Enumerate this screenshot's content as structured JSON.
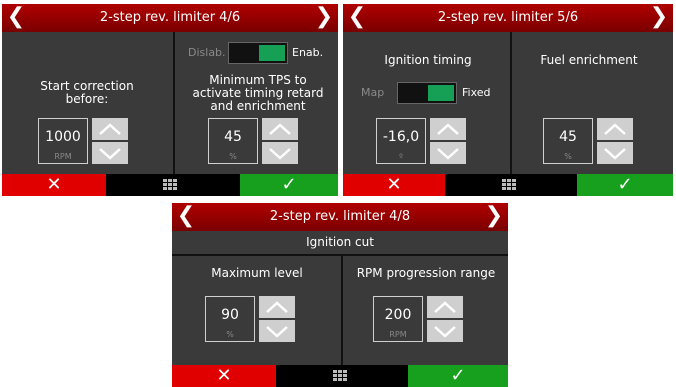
{
  "screen1": {
    "title": "2-step rev. limiter 4/6",
    "left_label": "Start correction before:",
    "left_value": "1000",
    "left_unit": "RPM",
    "toggle_off": "Dislab.",
    "toggle_on": "Enab.",
    "right_label": "Minimum TPS to activate timing retard and enrichment",
    "right_value": "45",
    "right_unit": "%"
  },
  "screen2": {
    "title": "2-step rev. limiter 5/6",
    "left_label": "Ignition timing",
    "toggle_off": "Map",
    "toggle_on": "Fixed",
    "left_value": "-16,0",
    "left_unit": "º",
    "right_label": "Fuel enrichment",
    "right_value": "45",
    "right_unit": "%"
  },
  "screen3": {
    "title": "2-step rev. limiter 4/8",
    "header": "Ignition cut",
    "left_label": "Maximum level",
    "left_value": "90",
    "left_unit": "%",
    "right_label": "RPM progression range",
    "right_value": "200",
    "right_unit": "RPM"
  },
  "glyphs": {
    "prev": "❮",
    "next": "❯",
    "cancel": "✕",
    "confirm": "✓"
  },
  "colors": {
    "titlebar": "#9b0000",
    "cancel": "#e00000",
    "confirm": "#16a01e",
    "toggle_on": "#15a055",
    "panel": "#3a3a3a"
  }
}
